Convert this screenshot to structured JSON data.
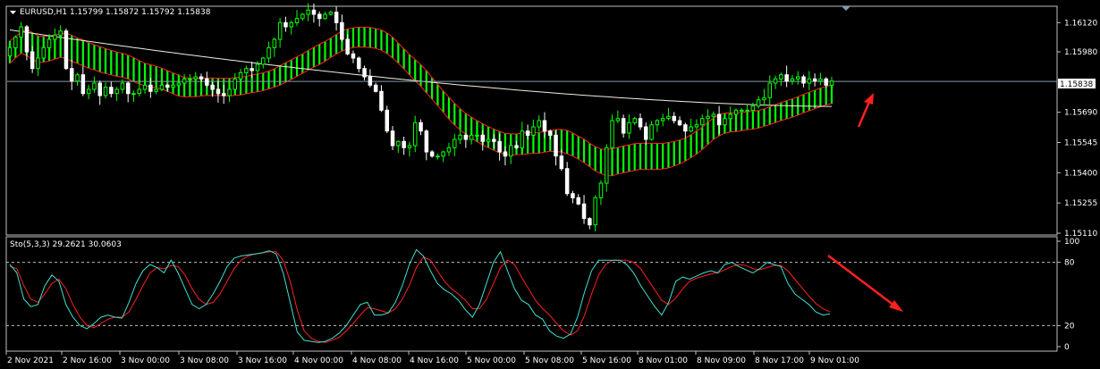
{
  "header": {
    "symbol_line": "EURUSD,H1  1.15799 1.15872 1.15792 1.15838",
    "indicator_line": "Sto(5,3,3) 29.2621 30.0603"
  },
  "colors": {
    "background": "#000000",
    "frame": "#c0c0c0",
    "bull": "#00ff00",
    "bear": "#ffffff",
    "ma_band_fill": "#00ff00",
    "ma_band_edge": "#ff2020",
    "long_ma": "#f0f0e0",
    "price_line": "#8899aa",
    "stoch_main": "#40e0d0",
    "stoch_signal": "#ff2020",
    "arrow": "#ff2020",
    "current_price_bg": "#ffffff",
    "current_price_fg": "#000000"
  },
  "chart_data": [
    {
      "type": "candlestick",
      "symbol": "EURUSD",
      "timeframe": "H1",
      "ylim": [
        1.1511,
        1.1619
      ],
      "y_ticks": [
        "1.16120",
        "1.15980",
        "1.15838",
        "1.15690",
        "1.15545",
        "1.15400",
        "1.15255",
        "1.15110"
      ],
      "current_price": "1.15838",
      "x_ticks": [
        "2 Nov 2021",
        "2 Nov 16:00",
        "3 Nov 00:00",
        "3 Nov 08:00",
        "3 Nov 16:00",
        "4 Nov 00:00",
        "4 Nov 08:00",
        "4 Nov 16:00",
        "5 Nov 00:00",
        "5 Nov 08:00",
        "5 Nov 16:00",
        "8 Nov 01:00",
        "8 Nov 09:00",
        "8 Nov 17:00",
        "9 Nov 01:00"
      ],
      "close": [
        1.16,
        1.1605,
        1.161,
        1.1598,
        1.159,
        1.1595,
        1.16,
        1.1604,
        1.1606,
        1.1608,
        1.159,
        1.1584,
        1.1587,
        1.1578,
        1.158,
        1.1583,
        1.1577,
        1.1581,
        1.1578,
        1.158,
        1.1583,
        1.1578,
        1.1578,
        1.158,
        1.1582,
        1.1579,
        1.158,
        1.1582,
        1.1581,
        1.1582,
        1.1583,
        1.1585,
        1.1585,
        1.1586,
        1.1585,
        1.1582,
        1.158,
        1.1578,
        1.1577,
        1.158,
        1.1585,
        1.1588,
        1.159,
        1.1589,
        1.1592,
        1.1595,
        1.16,
        1.1604,
        1.1612,
        1.161,
        1.1612,
        1.1614,
        1.1616,
        1.1618,
        1.1616,
        1.1614,
        1.1616,
        1.1617,
        1.1612,
        1.1604,
        1.1597,
        1.1595,
        1.159,
        1.1586,
        1.1582,
        1.1579,
        1.157,
        1.156,
        1.1553,
        1.1555,
        1.1552,
        1.1553,
        1.1564,
        1.156,
        1.155,
        1.1548,
        1.1548,
        1.155,
        1.1552,
        1.1556,
        1.1558,
        1.1556,
        1.1558,
        1.1558,
        1.1555,
        1.1556,
        1.1555,
        1.155,
        1.1548,
        1.1553,
        1.1552,
        1.156,
        1.1558,
        1.1562,
        1.1565,
        1.156,
        1.1558,
        1.1548,
        1.1542,
        1.153,
        1.1528,
        1.1525,
        1.1518,
        1.1515,
        1.1528,
        1.1535,
        1.1552,
        1.1565,
        1.1566,
        1.1559,
        1.1564,
        1.1566,
        1.1562,
        1.1556,
        1.1563,
        1.1565,
        1.1566,
        1.1567,
        1.1565,
        1.1563,
        1.156,
        1.1562,
        1.1563,
        1.1566,
        1.1567,
        1.1568,
        1.1563,
        1.1566,
        1.1568,
        1.157,
        1.157,
        1.157,
        1.1572,
        1.1575,
        1.1576,
        1.1583,
        1.1585,
        1.1587,
        1.1584,
        1.1585,
        1.1586,
        1.1583,
        1.1585,
        1.1584,
        1.1585,
        1.1582,
        1.1584
      ],
      "stochastic": {
        "name": "Sto(5,3,3)",
        "ylim": [
          0,
          100
        ],
        "levels": [
          80,
          20
        ],
        "y_ticks": [
          "100",
          "80",
          "20",
          "0"
        ],
        "main": [
          78,
          70,
          45,
          38,
          40,
          58,
          68,
          62,
          40,
          28,
          20,
          17,
          22,
          28,
          30,
          28,
          27,
          42,
          60,
          72,
          78,
          75,
          70,
          82,
          70,
          55,
          40,
          36,
          40,
          50,
          62,
          76,
          84,
          86,
          87,
          88,
          89,
          91,
          88,
          70,
          42,
          14,
          6,
          5,
          4,
          5,
          8,
          13,
          20,
          30,
          40,
          42,
          30,
          30,
          32,
          42,
          58,
          78,
          92,
          86,
          72,
          60,
          54,
          50,
          44,
          35,
          28,
          40,
          60,
          80,
          90,
          72,
          55,
          44,
          40,
          30,
          26,
          15,
          10,
          8,
          12,
          28,
          52,
          72,
          82,
          82,
          82,
          82,
          78,
          70,
          58,
          48,
          38,
          30,
          42,
          62,
          66,
          64,
          67,
          70,
          72,
          70,
          78,
          80,
          76,
          73,
          70,
          74,
          80,
          78,
          76,
          60,
          50,
          45,
          40,
          33,
          30,
          31
        ],
        "signal": [
          76,
          74,
          58,
          45,
          42,
          50,
          60,
          64,
          55,
          40,
          28,
          20,
          18,
          22,
          26,
          28,
          28,
          33,
          45,
          58,
          70,
          75,
          74,
          77,
          76,
          68,
          55,
          45,
          40,
          42,
          50,
          62,
          74,
          82,
          86,
          88,
          89,
          90,
          90,
          82,
          62,
          35,
          15,
          8,
          5,
          4,
          6,
          9,
          15,
          22,
          30,
          37,
          36,
          34,
          32,
          36,
          45,
          58,
          75,
          85,
          82,
          72,
          62,
          55,
          50,
          44,
          36,
          36,
          45,
          60,
          75,
          82,
          78,
          66,
          55,
          44,
          36,
          30,
          22,
          15,
          11,
          15,
          30,
          50,
          68,
          78,
          82,
          82,
          82,
          80,
          74,
          64,
          54,
          44,
          40,
          46,
          55,
          62,
          65,
          67,
          69,
          70,
          73,
          76,
          78,
          77,
          74,
          73,
          75,
          77,
          77,
          72,
          64,
          56,
          48,
          41,
          36,
          33
        ]
      }
    }
  ]
}
